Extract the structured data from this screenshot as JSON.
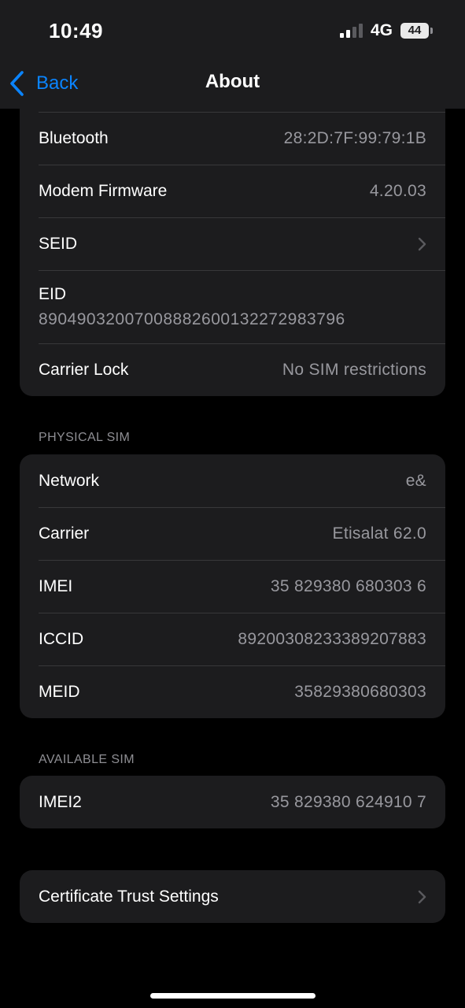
{
  "status_bar": {
    "time": "10:49",
    "network": "4G",
    "battery": "44"
  },
  "nav": {
    "back_label": "Back",
    "title": "About"
  },
  "group1": [
    {
      "label": "Bluetooth",
      "value": "28:2D:7F:99:79:1B"
    },
    {
      "label": "Modem Firmware",
      "value": "4.20.03"
    },
    {
      "label": "SEID",
      "value": ""
    },
    {
      "label": "EID",
      "value": "89049032007008882600132272983796"
    },
    {
      "label": "Carrier Lock",
      "value": "No SIM restrictions"
    }
  ],
  "physical_sim": {
    "header": "PHYSICAL SIM",
    "rows": [
      {
        "label": "Network",
        "value": "e&"
      },
      {
        "label": "Carrier",
        "value": "Etisalat 62.0"
      },
      {
        "label": "IMEI",
        "value": "35 829380 680303 6"
      },
      {
        "label": "ICCID",
        "value": "89200308233389207883"
      },
      {
        "label": "MEID",
        "value": "35829380680303"
      }
    ]
  },
  "available_sim": {
    "header": "AVAILABLE SIM",
    "rows": [
      {
        "label": "IMEI2",
        "value": "35 829380 624910 7"
      }
    ]
  },
  "certificate": {
    "label": "Certificate Trust Settings"
  },
  "colors": {
    "accent": "#0a84ff",
    "background": "#000000",
    "group": "#1c1c1e",
    "secondary_text": "#98989e"
  },
  "icons": {
    "back": "chevron-left-icon",
    "disclosure": "chevron-right-icon"
  }
}
